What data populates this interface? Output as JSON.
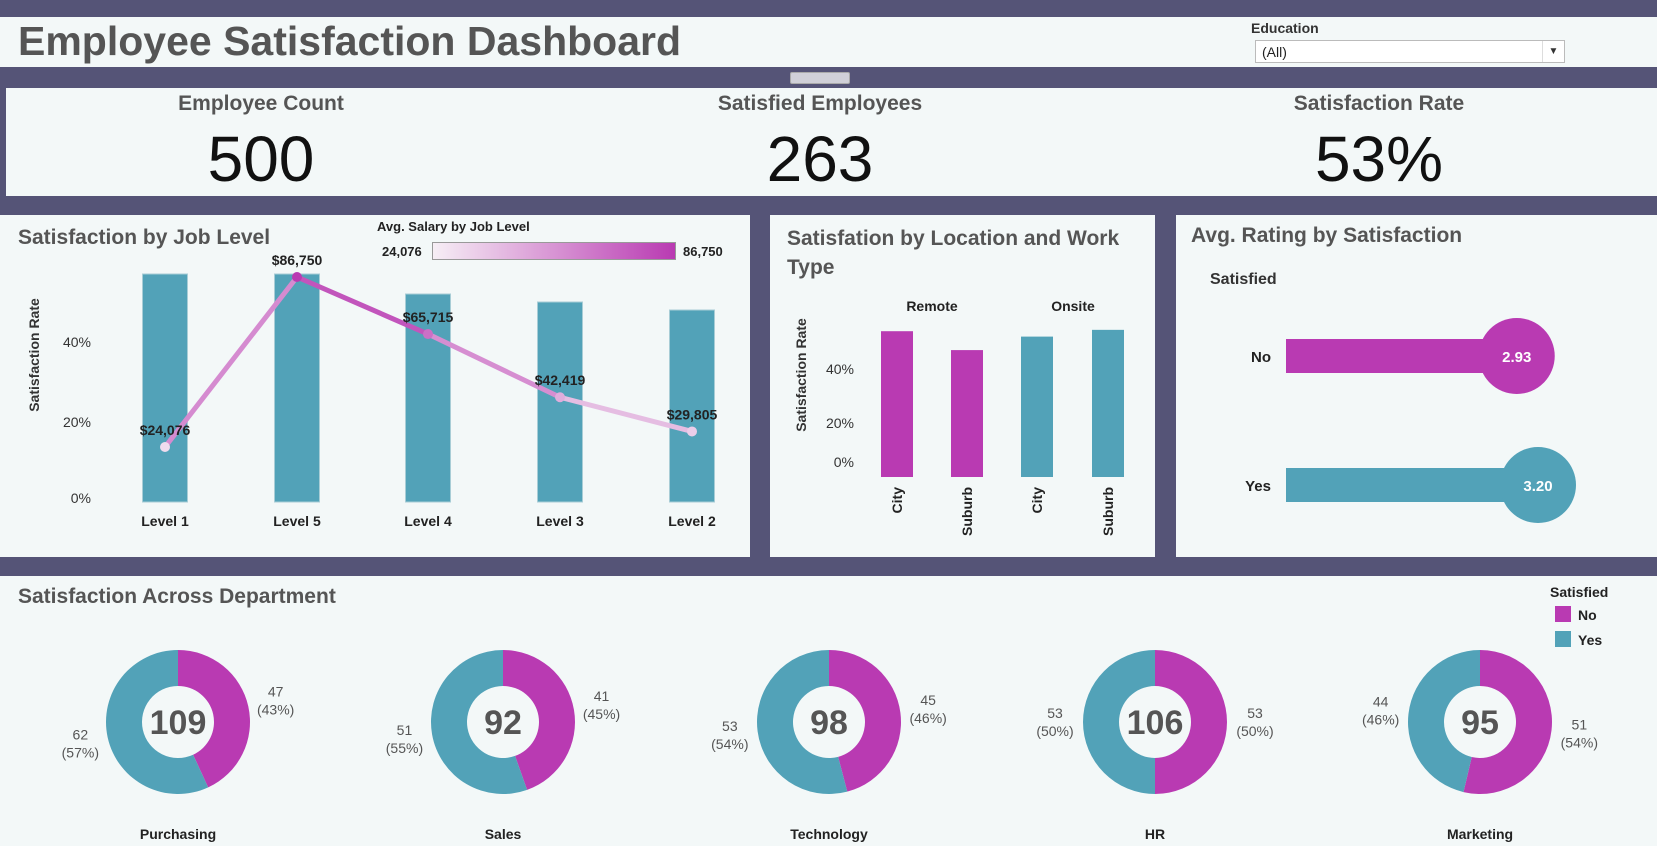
{
  "header": {
    "title": "Employee Satisfaction Dashboard",
    "filter_label": "Education",
    "filter_value": "(All)"
  },
  "kpis": [
    {
      "label": "Employee Count",
      "value": "500"
    },
    {
      "label": "Satisfied Employees",
      "value": "263"
    },
    {
      "label": "Satisfaction Rate",
      "value": "53%"
    }
  ],
  "colors": {
    "no": "#b93ab2",
    "yes": "#52a2b8",
    "frame": "#555477"
  },
  "job_level": {
    "title": "Satisfaction by Job Level",
    "legend_title": "Avg. Salary by Job Level",
    "legend_min": "24,076",
    "legend_max": "86,750",
    "y_axis_label": "Satisfaction Rate"
  },
  "location": {
    "title": "Satisfation by Location and Work Type",
    "y_axis_label": "Satisfaction Rate"
  },
  "rating": {
    "title": "Avg. Rating by Satisfaction",
    "header": "Satisfied"
  },
  "department": {
    "title": "Satisfaction Across Department",
    "legend_title": "Satisfied",
    "legend_no": "No",
    "legend_yes": "Yes"
  },
  "chart_data": [
    {
      "type": "bar",
      "title": "Satisfaction by Job Level",
      "ylabel": "Satisfaction Rate",
      "categories": [
        "Level 1",
        "Level 5",
        "Level 4",
        "Level 3",
        "Level 2"
      ],
      "y_ticks": [
        "0%",
        "20%",
        "40%"
      ],
      "ylim": [
        0,
        0.6
      ],
      "values": [
        0.57,
        0.57,
        0.52,
        0.5,
        0.48
      ],
      "overlay_line": {
        "name": "Avg. Salary by Job Level",
        "values": [
          24076,
          86750,
          65715,
          42419,
          29805
        ],
        "labels": [
          "$24,076",
          "$86,750",
          "$65,715",
          "$42,419",
          "$29,805"
        ]
      }
    },
    {
      "type": "bar",
      "title": "Satisfation by Location and Work Type",
      "ylabel": "Satisfaction Rate",
      "groups": [
        "Remote",
        "Onsite"
      ],
      "categories": [
        "City",
        "Suburb",
        "City",
        "Suburb"
      ],
      "y_ticks": [
        "0%",
        "20%",
        "40%"
      ],
      "ylim": [
        0,
        0.6
      ],
      "values": [
        0.54,
        0.47,
        0.52,
        0.545
      ],
      "colors": [
        "#b93ab2",
        "#b93ab2",
        "#52a2b8",
        "#52a2b8"
      ]
    },
    {
      "type": "bar",
      "title": "Avg. Rating by Satisfaction",
      "categories": [
        "No",
        "Yes"
      ],
      "values": [
        2.93,
        3.2
      ],
      "labels": [
        "2.93",
        "3.20"
      ]
    },
    {
      "type": "pie",
      "title": "Satisfaction Across Department",
      "series": [
        {
          "name": "Purchasing",
          "total": "109",
          "no": 47,
          "yes": 62,
          "no_label": "47",
          "no_pct": "(43%)",
          "yes_label": "62",
          "yes_pct": "(57%)"
        },
        {
          "name": "Sales",
          "total": "92",
          "no": 41,
          "yes": 51,
          "no_label": "41",
          "no_pct": "(45%)",
          "yes_label": "51",
          "yes_pct": "(55%)"
        },
        {
          "name": "Technology",
          "total": "98",
          "no": 45,
          "yes": 53,
          "no_label": "45",
          "no_pct": "(46%)",
          "yes_label": "53",
          "yes_pct": "(54%)"
        },
        {
          "name": "HR",
          "total": "106",
          "no": 53,
          "yes": 53,
          "no_label": "53",
          "no_pct": "(50%)",
          "yes_label": "53",
          "yes_pct": "(50%)"
        },
        {
          "name": "Marketing",
          "total": "95",
          "no": 51,
          "yes": 44,
          "no_label": "51",
          "no_pct": "(54%)",
          "yes_label": "44",
          "yes_pct": "(46%)"
        }
      ]
    }
  ]
}
